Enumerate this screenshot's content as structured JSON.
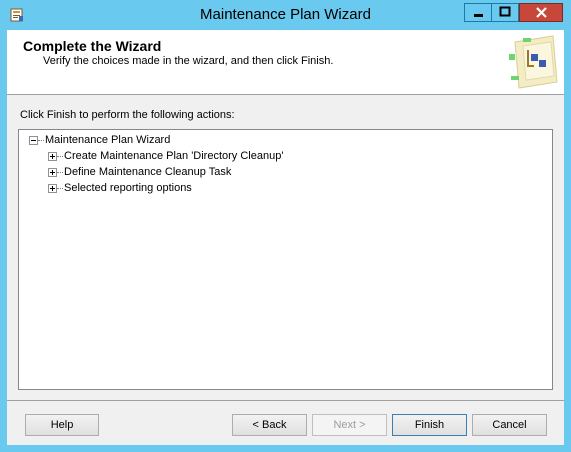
{
  "window": {
    "title": "Maintenance Plan Wizard",
    "icon": "maintenance-plan-icon",
    "titlebar_color": "#6ac9ee",
    "close_color": "#c7473b"
  },
  "header": {
    "title": "Complete the Wizard",
    "subtitle": "Verify the choices made in the wizard, and then click Finish.",
    "art": "wizard-graphic"
  },
  "instructions": "Click Finish to perform the following actions:",
  "tree": {
    "root": {
      "label": "Maintenance Plan Wizard",
      "expanded": true
    },
    "children": [
      {
        "label": "Create Maintenance Plan 'Directory Cleanup'",
        "expanded": false
      },
      {
        "label": "Define Maintenance Cleanup Task",
        "expanded": false
      },
      {
        "label": "Selected reporting options",
        "expanded": false
      }
    ]
  },
  "buttons": {
    "help": "Help",
    "back": "< Back",
    "next": "Next >",
    "finish": "Finish",
    "cancel": "Cancel"
  }
}
